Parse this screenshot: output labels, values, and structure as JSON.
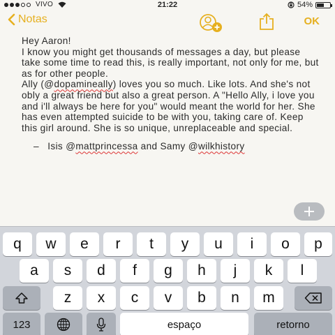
{
  "status_bar": {
    "signal_dots_filled": 3,
    "signal_dots_total": 5,
    "carrier": "VIVO",
    "time": "21:22",
    "battery_text": "54%",
    "battery_level": 0.54
  },
  "nav": {
    "back_label": "Notas",
    "ok_label": "OK"
  },
  "note": {
    "greeting": "Hey Aaron!",
    "p1": "I know you might get thousands of messages a day, but please take some time to read this, is really important, not only for me, but as for other people.",
    "p2_before": "Ally (@",
    "p2_mention": "dopamineally",
    "p2_after": ") loves you so much. Like lots. And she's not obly a great friend but also a great person. A \"Hello Ally, i love you and i'll always be here for you\" would meant the world for her. She has even attempted suicide to be with you, taking care of. Keep this girl around. She is so unique, unreplaceable and special.",
    "sig_prefix": "–   Isis @",
    "sig_mention1": "mattprincessa",
    "sig_middle": " and Samy @",
    "sig_mention2": "wilkhistory"
  },
  "keyboard": {
    "row1": [
      "q",
      "w",
      "e",
      "r",
      "t",
      "y",
      "u",
      "i",
      "o",
      "p"
    ],
    "row2": [
      "a",
      "s",
      "d",
      "f",
      "g",
      "h",
      "j",
      "k",
      "l"
    ],
    "row3": [
      "z",
      "x",
      "c",
      "v",
      "b",
      "n",
      "m"
    ],
    "numbers_label": "123",
    "space_label": "espaço",
    "return_label": "retorno"
  }
}
